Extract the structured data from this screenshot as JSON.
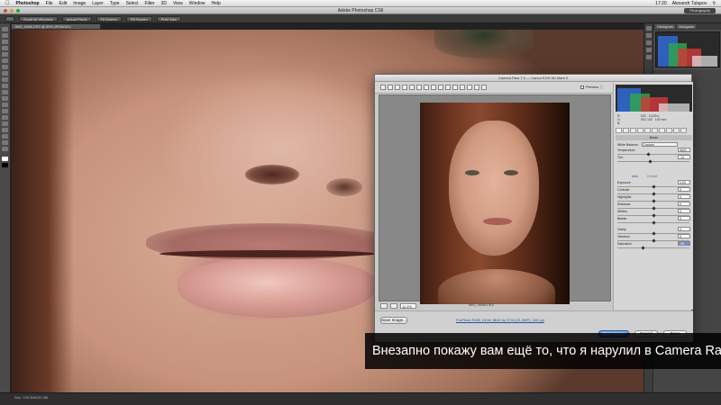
{
  "menubar": {
    "app": "Photoshop",
    "items": [
      "File",
      "Edit",
      "Image",
      "Layer",
      "Type",
      "Select",
      "Filter",
      "3D",
      "View",
      "Window",
      "Help"
    ],
    "clock": "17:20",
    "user": "Alexandr Tulupov"
  },
  "ps_window": {
    "title": "Adobe Photoshop CS6",
    "workspace": "Photography"
  },
  "options_bar": {
    "items": [
      "Scroll All Windows",
      "Actual Pixels",
      "Fit Screen",
      "Fill Screen",
      "Print Size"
    ]
  },
  "document": {
    "tab": "IMG_0498.CR2 @ 50% (RGB/16*)"
  },
  "status_bar": {
    "text": "Doc: 120,3M/120,3M"
  },
  "panels": {
    "tabs": [
      "Histogram",
      "Navigator"
    ]
  },
  "camera_raw": {
    "title": "Camera Raw 7.0 — Canon EOS 5D Mark II",
    "preview_label": "Preview",
    "readout": {
      "rgb": [
        "R:",
        "G:",
        "B:"
      ],
      "exif": "f/22   1/125 s\nISO 100   100 mm"
    },
    "panel_title": "Basic",
    "white_balance": {
      "label": "White Balance:",
      "value": "Custom"
    },
    "auto_label": "Auto",
    "default_label": "Default",
    "sliders": [
      {
        "label": "Temperature",
        "value": "5800",
        "pos": 0.42
      },
      {
        "label": "Tint",
        "value": "-14",
        "pos": 0.45
      },
      {
        "label": "Exposure",
        "value": "0.00",
        "pos": 0.5
      },
      {
        "label": "Contrast",
        "value": "0",
        "pos": 0.5
      },
      {
        "label": "Highlights",
        "value": "0",
        "pos": 0.5
      },
      {
        "label": "Shadows",
        "value": "0",
        "pos": 0.5
      },
      {
        "label": "Whites",
        "value": "0",
        "pos": 0.5
      },
      {
        "label": "Blacks",
        "value": "0",
        "pos": 0.5
      },
      {
        "label": "Clarity",
        "value": "0",
        "pos": 0.5
      },
      {
        "label": "Vibrance",
        "value": "0",
        "pos": 0.5
      },
      {
        "label": "Saturation",
        "value": "-30",
        "pos": 0.35,
        "highlight": true
      }
    ],
    "zoom": "11.9%",
    "filename": "IMG_0498.CR2",
    "save_button": "Save Image...",
    "workflow": "ProPhoto RGB; 16 bit; 5616 by 3744 (21,0MP); 240 ppi",
    "open_button": "Open Image",
    "cancel_button": "Cancel",
    "done_button": "Done"
  },
  "subtitle": "Внезапно покажу вам ещё то, что я нарулил в Camera Raw"
}
